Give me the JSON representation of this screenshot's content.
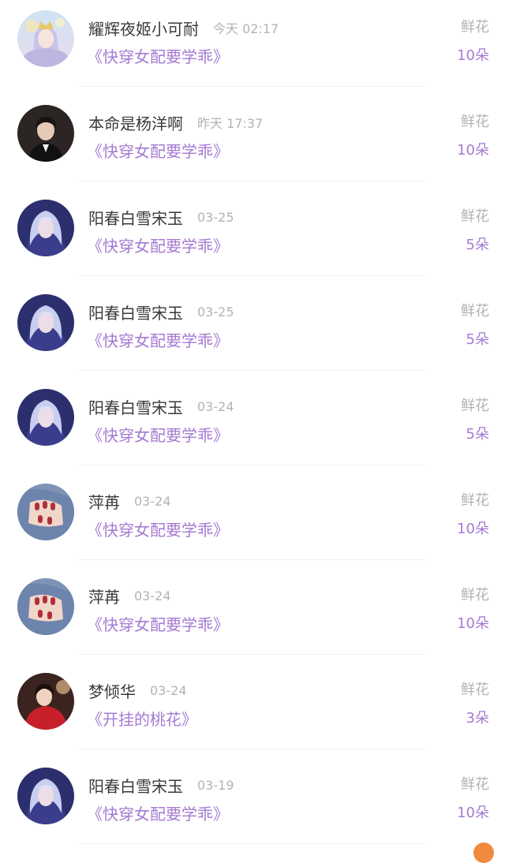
{
  "gift_records": [
    {
      "avatar": "fantasy-princess-avatar",
      "user": "耀辉夜姬小可耐",
      "time": "今天 02:17",
      "book": "《快穿女配要学乖》",
      "gift": "鲜花",
      "count": "10朵"
    },
    {
      "avatar": "man-in-suit-avatar",
      "user": "本命是杨洋啊",
      "time": "昨天 17:37",
      "book": "《快穿女配要学乖》",
      "gift": "鲜花",
      "count": "10朵"
    },
    {
      "avatar": "silver-hair-character-avatar",
      "user": "阳春白雪宋玉",
      "time": "03-25",
      "book": "《快穿女配要学乖》",
      "gift": "鲜花",
      "count": "5朵"
    },
    {
      "avatar": "silver-hair-character-avatar",
      "user": "阳春白雪宋玉",
      "time": "03-25",
      "book": "《快穿女配要学乖》",
      "gift": "鲜花",
      "count": "5朵"
    },
    {
      "avatar": "silver-hair-character-avatar",
      "user": "阳春白雪宋玉",
      "time": "03-24",
      "book": "《快穿女配要学乖》",
      "gift": "鲜花",
      "count": "5朵"
    },
    {
      "avatar": "manicure-hands-avatar",
      "user": "萍苒",
      "time": "03-24",
      "book": "《快穿女配要学乖》",
      "gift": "鲜花",
      "count": "10朵"
    },
    {
      "avatar": "manicure-hands-avatar",
      "user": "萍苒",
      "time": "03-24",
      "book": "《快穿女配要学乖》",
      "gift": "鲜花",
      "count": "10朵"
    },
    {
      "avatar": "woman-red-dress-avatar",
      "user": "梦倾华",
      "time": "03-24",
      "book": "《开挂的桃花》",
      "gift": "鲜花",
      "count": "3朵"
    },
    {
      "avatar": "silver-hair-character-avatar",
      "user": "阳春白雪宋玉",
      "time": "03-19",
      "book": "《快穿女配要学乖》",
      "gift": "鲜花",
      "count": "10朵"
    }
  ],
  "colors": {
    "accent": "#a57ad2",
    "name": "#3a3a3a",
    "muted": "#b3b3b3",
    "divider": "#f0f0f0",
    "badge": "#f08a3c"
  }
}
